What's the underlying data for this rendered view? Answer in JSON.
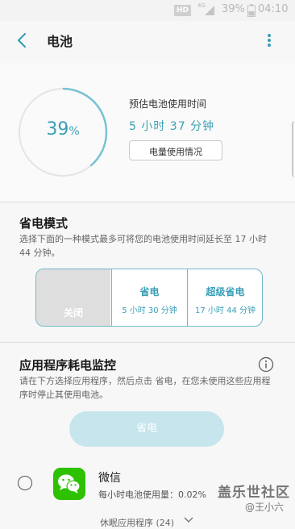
{
  "status_bar": {
    "hd": "HD",
    "network": "4G",
    "battery_percent": "39%",
    "time": "04:10"
  },
  "header": {
    "title": "电池"
  },
  "battery": {
    "level_number": "39",
    "level_unit": "%",
    "level_fraction": 0.39,
    "estimate_label": "预估电池使用时间",
    "estimate_value": "5 小时 37 分钟",
    "usage_button": "电量使用情况"
  },
  "power_saving": {
    "title": "省电模式",
    "description": "选择下面的一种模式最多可将您的电池使用时间延长至 17 小时 44 分钟。",
    "modes": [
      {
        "label": "关闭",
        "sub": "",
        "selected": true
      },
      {
        "label": "省电",
        "sub": "5 小时 30 分钟",
        "selected": false
      },
      {
        "label": "超级省电",
        "sub": "17 小时 44 分钟",
        "selected": false
      }
    ]
  },
  "app_monitor": {
    "title": "应用程序耗电监控",
    "description": "请在下方选择应用程序，然后点击 省电，在您未使用这些应用程序时停止其使用电池。",
    "save_button": "省电",
    "apps": [
      {
        "name": "微信",
        "usage": "每小时电池使用量：0.02%"
      }
    ],
    "collapsed_label": "休眠应用程序 (24)"
  },
  "watermark": {
    "main": "盖乐世社区",
    "sub": "@王小六"
  },
  "colors": {
    "accent": "#3a9fb6",
    "border_accent": "#6fb8cb",
    "button_disabled": "#c6e5ec",
    "wechat_green": "#2dc100"
  }
}
